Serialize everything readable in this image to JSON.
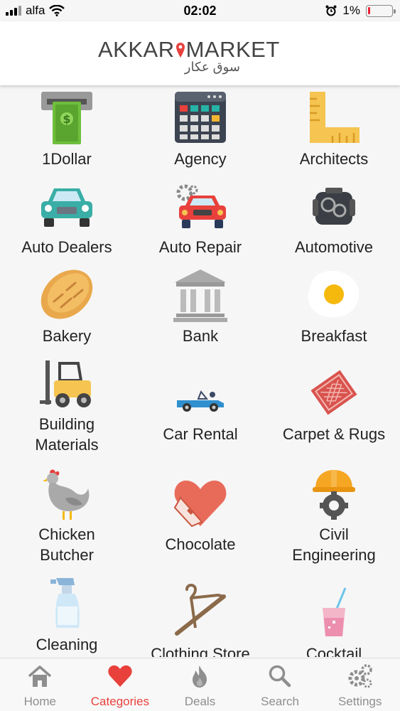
{
  "status_bar": {
    "carrier": "alfa",
    "time": "02:02",
    "battery": "1%",
    "battery_level": 0.01
  },
  "header": {
    "logo_left": "AKKAR",
    "logo_right": "MARKET",
    "logo_arabic": "سوق عكار"
  },
  "categories": [
    {
      "label": "1Dollar",
      "icon": "money-icon"
    },
    {
      "label": "Agency",
      "icon": "calculator-icon"
    },
    {
      "label": "Architects",
      "icon": "ruler-icon"
    },
    {
      "label": "Auto Dealers",
      "icon": "car-icon"
    },
    {
      "label": "Auto Repair",
      "icon": "car-repair-icon"
    },
    {
      "label": "Automotive",
      "icon": "engine-icon"
    },
    {
      "label": "Bakery",
      "icon": "bread-icon"
    },
    {
      "label": "Bank",
      "icon": "bank-icon"
    },
    {
      "label": "Breakfast",
      "icon": "fried-egg-icon"
    },
    {
      "label": "Building\nMaterials",
      "icon": "forklift-icon"
    },
    {
      "label": "Car Rental",
      "icon": "convertible-car-icon"
    },
    {
      "label": "Carpet & Rugs",
      "icon": "rug-icon"
    },
    {
      "label": "Chicken\nButcher",
      "icon": "chicken-icon"
    },
    {
      "label": "Chocolate",
      "icon": "heart-chocolate-icon"
    },
    {
      "label": "Civil\nEngineering",
      "icon": "hardhat-gear-icon"
    },
    {
      "label": "Cleaning",
      "icon": "spray-bottle-icon"
    },
    {
      "label": "Clothing Store",
      "icon": "hanger-icon"
    },
    {
      "label": "Cocktail",
      "icon": "cocktail-icon"
    }
  ],
  "tabs": [
    {
      "label": "Home",
      "icon": "home-icon",
      "active": false
    },
    {
      "label": "Categories",
      "icon": "heart-icon",
      "active": true
    },
    {
      "label": "Deals",
      "icon": "flame-icon",
      "active": false
    },
    {
      "label": "Search",
      "icon": "search-icon",
      "active": false
    },
    {
      "label": "Settings",
      "icon": "gears-icon",
      "active": false
    }
  ],
  "colors": {
    "accent": "#e8413c",
    "tab_inactive": "#8e8e8e"
  }
}
